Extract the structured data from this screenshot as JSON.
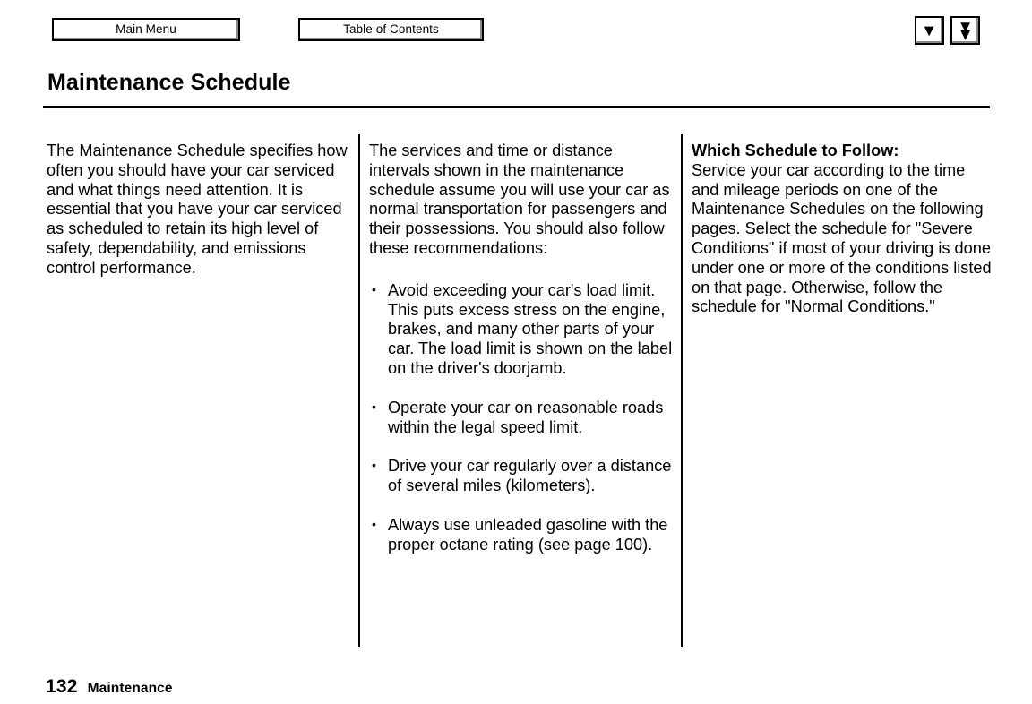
{
  "toolbar": {
    "main_menu_label": "Main Menu",
    "table_of_contents_label": "Table of Contents",
    "prev_icon": "single-triangle-icon",
    "next_icon": "double-triangle-icon",
    "prev_glyph": "▶",
    "next_glyph": "▶▶"
  },
  "header": {
    "title": "Maintenance Schedule"
  },
  "content": {
    "column_1": {
      "paragraph": "The Maintenance Schedule specifies how often you should have your car serviced and what things need attention. It is essential that you have your car serviced as scheduled to retain its high level of safety, dependability, and emissions control performance."
    },
    "column_2": {
      "paragraph": "The services and time or distance intervals shown in the maintenance schedule assume you will use your car as normal transportation for passengers and their possessions. You should also follow these recommendations:",
      "bullets": [
        "Avoid exceeding your car's load limit. This puts excess stress on the engine, brakes, and many other parts of your car. The load limit is shown on the label on the driver's doorjamb.",
        "Operate your car on reasonable roads within the legal speed limit.",
        "Drive your car regularly over a distance of several miles (kilometers).",
        "Always use unleaded gasoline with the proper octane rating (see page 100)."
      ]
    },
    "column_3": {
      "heading": "Which Schedule to Follow:",
      "paragraph": "Service your car according to the time and mileage periods on one of the Maintenance Schedules on the following pages. Select the schedule for \"Severe Conditions\" if most of your driving is done under one or more of the conditions listed on that page. Otherwise, follow the schedule for \"Normal Conditions.\""
    }
  },
  "footer": {
    "page_number": "132",
    "section_label": "Maintenance"
  },
  "colors": {
    "text": "#000000",
    "background": "#ffffff",
    "button_shadow": "#8a8a8a"
  }
}
